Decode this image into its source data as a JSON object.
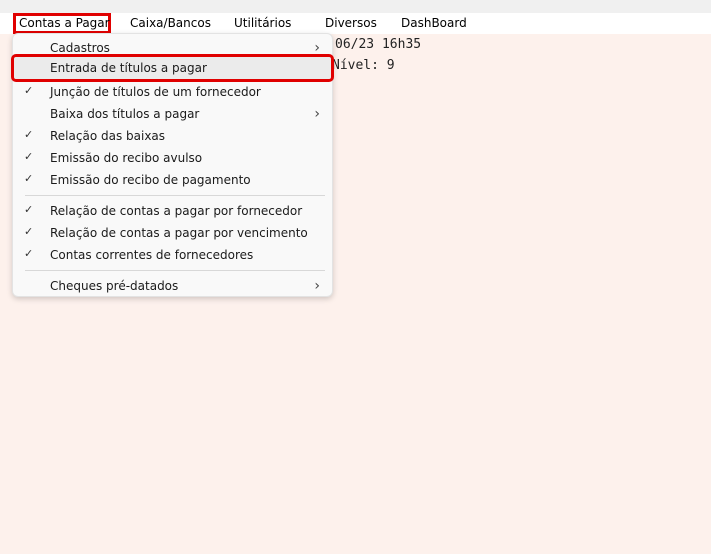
{
  "menubar": {
    "items": [
      {
        "label": "Contas a Pagar"
      },
      {
        "label": "Caixa/Bancos"
      },
      {
        "label": "Utilitários"
      },
      {
        "label": "Diversos"
      },
      {
        "label": "DashBoard"
      }
    ]
  },
  "console": {
    "line1": "06/23 16h35",
    "line2": "Nível: 9"
  },
  "dropdown": {
    "items": [
      {
        "label": "Cadastros",
        "checked": false,
        "submenu": true
      },
      {
        "label": "Entrada de títulos a pagar",
        "checked": false,
        "submenu": false
      },
      {
        "label": "Junção de títulos de um fornecedor",
        "checked": true,
        "submenu": false
      },
      {
        "label": "Baixa dos títulos a pagar",
        "checked": false,
        "submenu": true
      },
      {
        "label": "Relação das baixas",
        "checked": true,
        "submenu": false
      },
      {
        "label": "Emissão do recibo avulso",
        "checked": true,
        "submenu": false
      },
      {
        "label": "Emissão do recibo de pagamento",
        "checked": true,
        "submenu": false
      },
      {
        "label": "Relação de contas a pagar por fornecedor",
        "checked": true,
        "submenu": false
      },
      {
        "label": "Relação de contas a pagar por vencimento",
        "checked": true,
        "submenu": false
      },
      {
        "label": "Contas correntes de fornecedores",
        "checked": true,
        "submenu": false
      },
      {
        "label": "Cheques pré-datados",
        "checked": false,
        "submenu": true
      }
    ]
  },
  "icons": {
    "check": "checkmark-icon",
    "arrow": "chevron-right-icon"
  },
  "colors": {
    "background": "#fdf1ec",
    "highlight_border": "#e00000"
  }
}
